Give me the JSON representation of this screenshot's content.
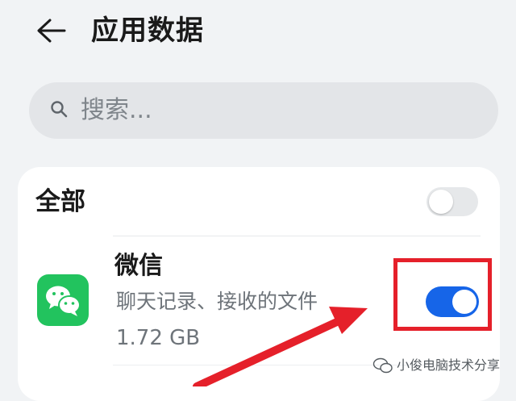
{
  "header": {
    "title": "应用数据",
    "back_icon": "back-arrow-icon"
  },
  "search": {
    "placeholder": "搜索...",
    "icon": "search-icon"
  },
  "list": {
    "all_label": "全部",
    "all_toggle": "off",
    "items": [
      {
        "name": "微信",
        "description": "聊天记录、接收的文件",
        "size": "1.72 GB",
        "icon": "wechat-icon",
        "icon_color": "#22c35e",
        "toggle": "on"
      }
    ]
  },
  "colors": {
    "accent": "#1665e8",
    "highlight": "#e5202a",
    "background": "#f1f3f5"
  },
  "watermark": {
    "text": "小俊电脑技术分享",
    "icon": "wechat-channel-icon"
  }
}
